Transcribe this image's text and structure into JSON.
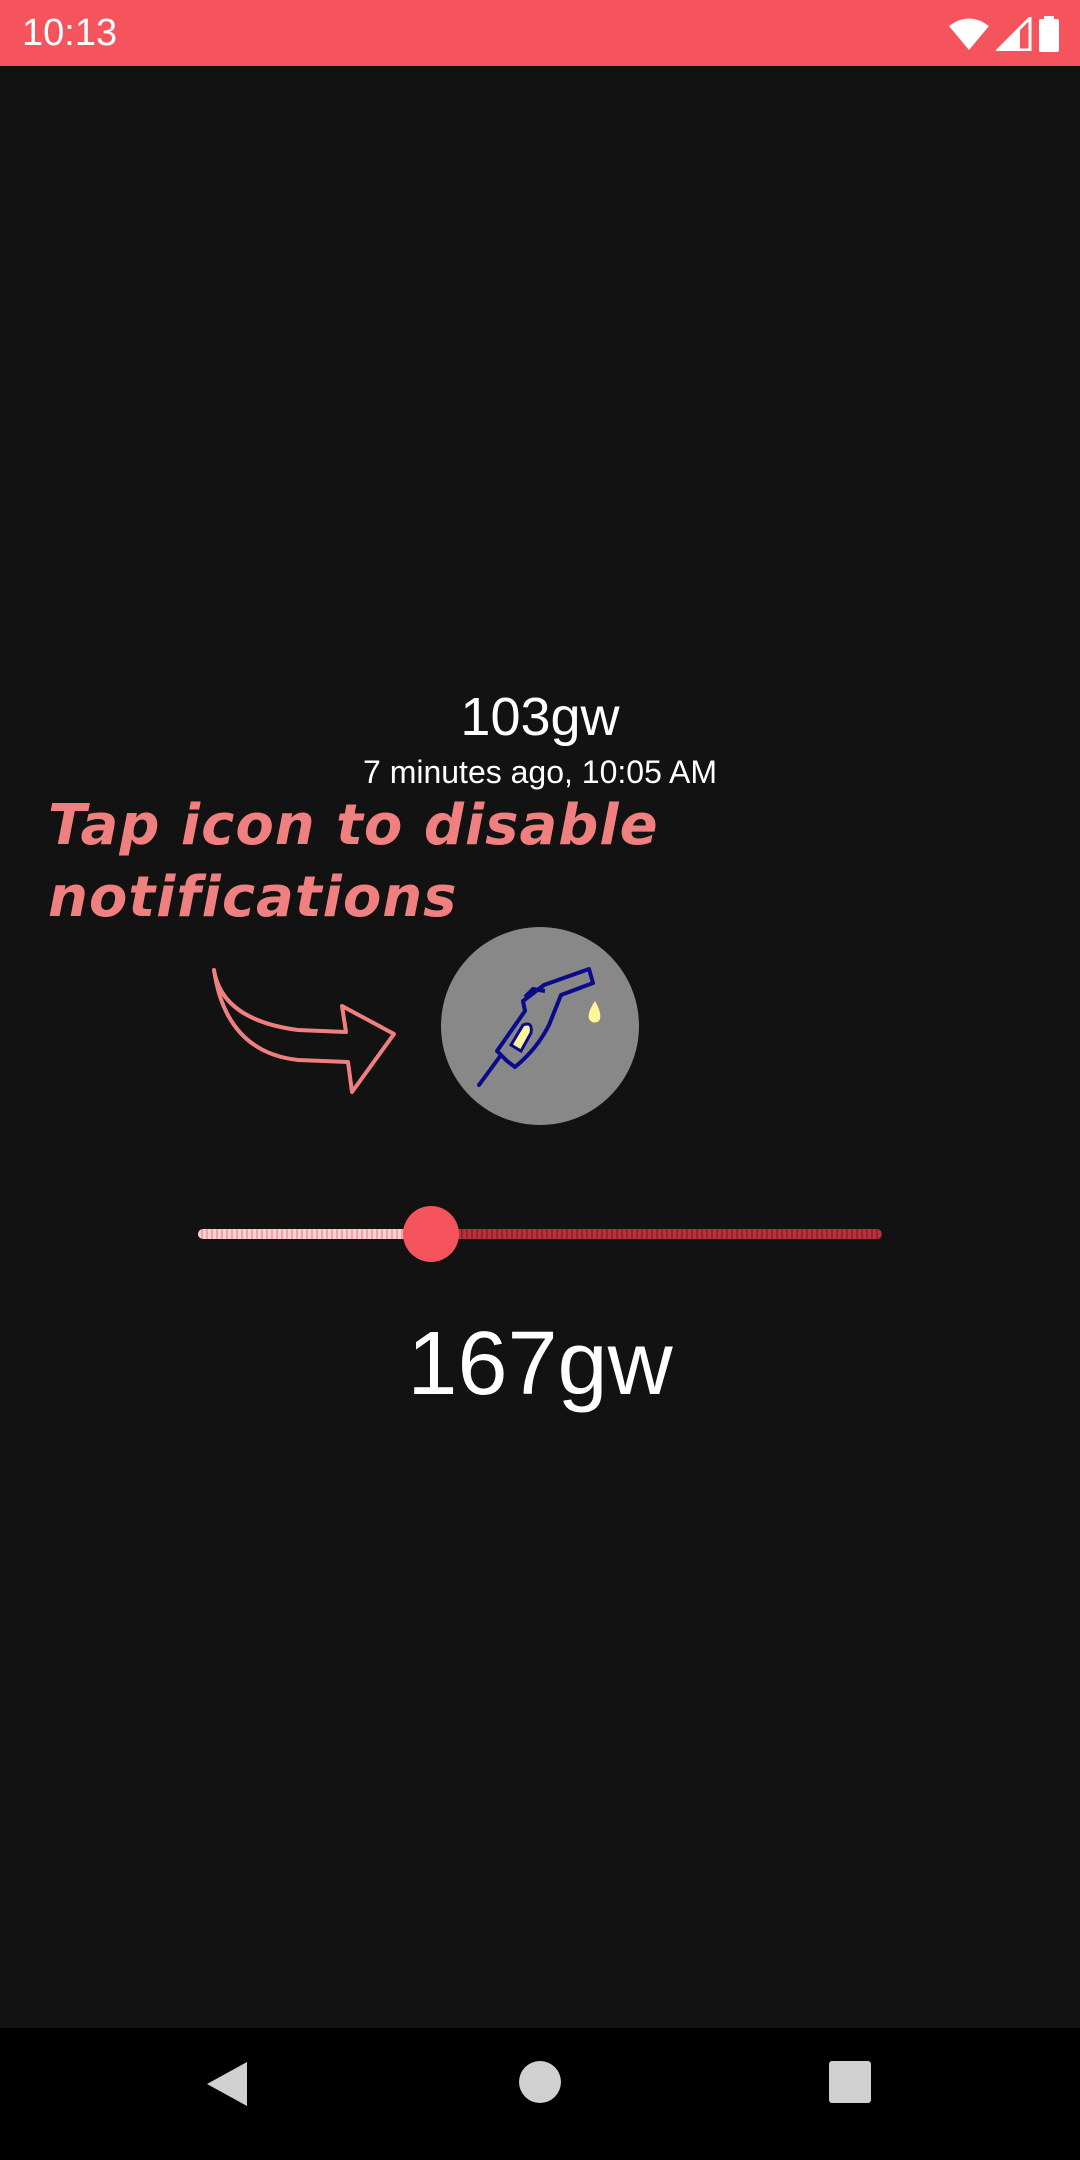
{
  "status_bar": {
    "time": "10:13",
    "background": "#f5545c",
    "icons": [
      "wifi-icon",
      "cell-signal-icon",
      "battery-icon"
    ]
  },
  "reading": {
    "value": "103gw",
    "time": "7 minutes ago, 10:05 AM"
  },
  "hint": {
    "text": "Tap icon to disable notifications",
    "color": "#f08080"
  },
  "fuel_button": {
    "icon": "fuel-pump-icon",
    "background": "#888888"
  },
  "slider": {
    "fraction": 0.34,
    "thumb_color": "#f5545c"
  },
  "target": {
    "value": "167gw"
  },
  "nav_bar": {
    "buttons": [
      "back-icon",
      "home-icon",
      "recents-icon"
    ]
  }
}
